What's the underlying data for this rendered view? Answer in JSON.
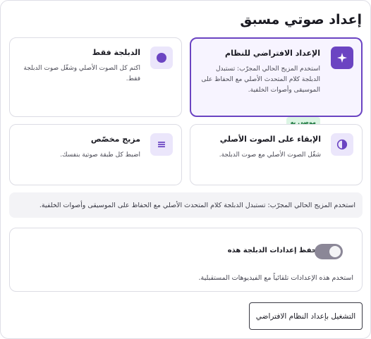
{
  "title": "إعداد صوتي مسبق",
  "presets": [
    {
      "id": "system",
      "title": "الإعداد الافتراضي للنظام",
      "description": "استخدم المزيج الحالي المجرّب: تستبدل الدبلجة كلام المتحدث الأصلي مع الحفاظ على الموسيقى وأصوات الخلفية.",
      "badge": "موصى به",
      "icon": "sparkle-icon",
      "selected": true
    },
    {
      "id": "dub-only",
      "title": "الدبلجة فقط",
      "description": "اكتم كل الصوت الأصلي وشغّل صوت الدبلجة فقط.",
      "icon": "filled-circle-icon",
      "selected": false
    },
    {
      "id": "keep-original",
      "title": "الإبقاء على الصوت الأصلي",
      "description": "شغّل الصوت الأصلي مع صوت الدبلجة.",
      "icon": "half-circle-icon",
      "selected": false
    },
    {
      "id": "custom",
      "title": "مزيج مخصّص",
      "description": "اضبط كل طبقة صوتية بنفسك.",
      "icon": "menu-lines-icon",
      "selected": false
    }
  ],
  "info_text": "استخدم المزيج الحالي المجرّب: تستبدل الدبلجة كلام المتحدث الأصلي مع الحفاظ على الموسيقى وأصوات الخلفية.",
  "save_settings": {
    "label": "حفظ إعدادات الدبلجة هذه",
    "description": "استخدم هذه الإعدادات تلقائياً مع الفيديوهات المستقبلية.",
    "enabled": true
  },
  "apply_button": "التشغيل بإعداد النظام الافتراضي",
  "colors": {
    "accent": "#6b44c2",
    "accent_light": "#ebe6fb",
    "badge_bg": "#dcf5e4",
    "badge_text": "#1e7a40",
    "toggle_on": "#8b8797"
  }
}
